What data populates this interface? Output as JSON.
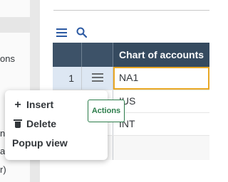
{
  "left_panel": {
    "fragments": [
      "ons",
      "n",
      "ac",
      "r)"
    ]
  },
  "toolbar": {
    "icons": [
      "hamburger-menu-icon",
      "search-icon"
    ]
  },
  "table": {
    "header": {
      "column_title": "Chart of accounts"
    },
    "rows": [
      {
        "number": "1",
        "value": "NA1"
      },
      {
        "number": "",
        "value": "IUS"
      },
      {
        "number": "",
        "value": "INT"
      },
      {
        "number": "",
        "value": ""
      }
    ]
  },
  "context_menu": {
    "items": [
      {
        "icon": "plus-icon",
        "label": "Insert"
      },
      {
        "icon": "trash-icon",
        "label": "Delete"
      },
      {
        "icon": "",
        "label": "Popup view"
      }
    ]
  },
  "tooltip": {
    "text": "Actions"
  },
  "colors": {
    "header_bg": "#354a5f",
    "selected_row_bg": "#dde7f3",
    "focus_border": "#e9a825",
    "tooltip_accent": "#2b7c4a",
    "toolbar_icon": "#2c5aa3"
  }
}
